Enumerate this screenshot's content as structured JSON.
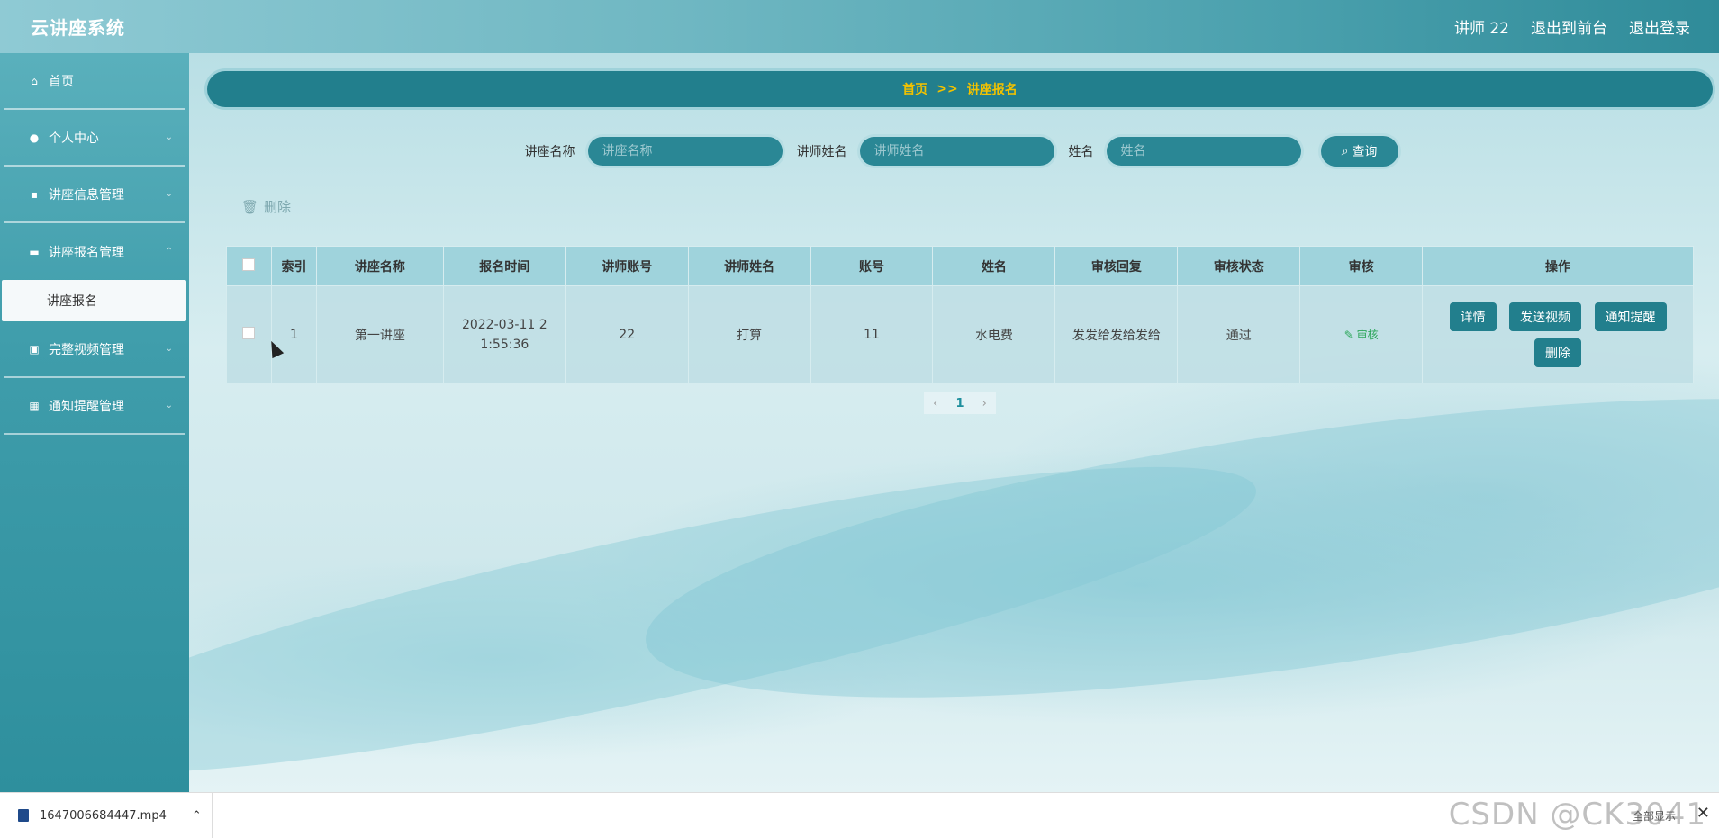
{
  "header": {
    "brand": "云讲座系统",
    "user": "讲师 22",
    "back_front": "退出到前台",
    "logout": "退出登录"
  },
  "sidebar": {
    "items": [
      {
        "label": "首页",
        "icon": "home-icon"
      },
      {
        "label": "个人中心",
        "icon": "user-icon"
      },
      {
        "label": "讲座信息管理",
        "icon": "signpost-icon"
      },
      {
        "label": "讲座报名管理",
        "icon": "monitor-icon"
      },
      {
        "label": "完整视频管理",
        "icon": "video-icon"
      },
      {
        "label": "通知提醒管理",
        "icon": "grid-icon"
      }
    ],
    "active_sub": "讲座报名"
  },
  "breadcrumb": {
    "home": "首页",
    "sep": ">>",
    "current": "讲座报名"
  },
  "search": {
    "lecture_label": "讲座名称",
    "lecture_placeholder": "讲座名称",
    "teacher_label": "讲师姓名",
    "teacher_placeholder": "讲师姓名",
    "name_label": "姓名",
    "name_placeholder": "姓名",
    "query_label": "查询"
  },
  "toolbar": {
    "delete_label": "删除"
  },
  "table": {
    "headers": [
      "索引",
      "讲座名称",
      "报名时间",
      "讲师账号",
      "讲师姓名",
      "账号",
      "姓名",
      "审核回复",
      "审核状态",
      "审核",
      "操作"
    ],
    "rows": [
      {
        "index": "1",
        "lecture": "第一讲座",
        "time": "2022-03-11 21:55:36",
        "teacher_account": "22",
        "teacher_name": "打算",
        "account": "11",
        "name": "水电费",
        "reply": "发发给发给发给",
        "status": "通过",
        "audit": "审核",
        "ops": [
          "详情",
          "发送视频",
          "通知提醒",
          "删除"
        ]
      }
    ]
  },
  "pager": {
    "current": "1"
  },
  "download": {
    "file": "1647006684447.mp4",
    "show_all": "全部显示"
  },
  "watermark": "CSDN @CK3041",
  "colors": {
    "primary": "#227f8d",
    "accent": "#f2c200",
    "audit": "#2ca65a"
  }
}
